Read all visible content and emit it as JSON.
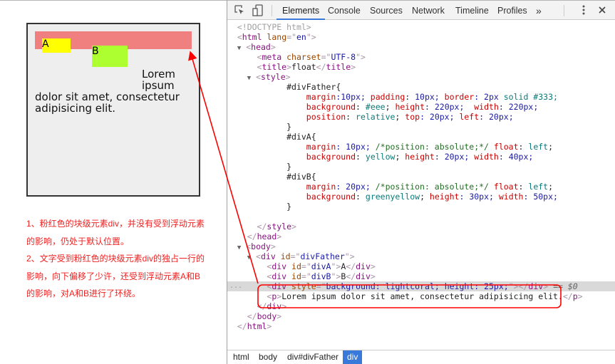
{
  "preview": {
    "box_a_label": "A",
    "box_b_label": "B",
    "paragraph_lines": [
      "Lorem",
      "ipsum",
      "dolor sit amet, consectetur",
      "adipisicing elit."
    ],
    "colors": {
      "coral": "#f08080",
      "yellow": "#ffff00",
      "greenyellow": "#adff2f",
      "father_bg": "#eeeeee",
      "father_border": "#333333"
    }
  },
  "notes": [
    "1、粉红色的块级元素div，并没有受到浮动元素的影响，仍处于默认位置。",
    "2、文字受到粉红色的块级元素div的独占一行的影响，向下偏移了少许，还受到浮动元素A和B的影响，对A和B进行了环绕。"
  ],
  "devtools": {
    "tabs": [
      "Elements",
      "Console",
      "Sources",
      "Network",
      "Timeline",
      "Profiles"
    ],
    "active_tab": "Elements",
    "more_tabs": "»",
    "icons": {
      "inspect": "inspect-element-icon",
      "device": "device-mode-icon",
      "menu": "kebab-menu-icon",
      "close": "close-icon"
    },
    "code": {
      "doctype": "<!DOCTYPE html>",
      "html_open": [
        "html",
        "lang",
        "en"
      ],
      "head": "head",
      "meta": [
        "meta",
        "charset",
        "UTF-8"
      ],
      "title": [
        "title",
        "float"
      ],
      "style": "style",
      "father_sel": "#divFather{",
      "father_l1": [
        "margin",
        ":10px; ",
        "padding",
        ": 10px; ",
        "border",
        ": 2px ",
        "solid",
        " #333;"
      ],
      "father_l2": [
        "background",
        ": ",
        "#eee",
        "; ",
        "height",
        ": 220px;  ",
        "width",
        ": 220px;"
      ],
      "father_l3": [
        "position",
        ": ",
        "relative",
        "; ",
        "top",
        ": 20px; ",
        "left",
        ": 20px;"
      ],
      "close_brace": "}",
      "a_sel": "#divA{",
      "a_l1": [
        "margin",
        ": 10px; ",
        "/*position: absolute;*/",
        " ",
        "float",
        ": ",
        "left",
        ";"
      ],
      "a_l2": [
        "background",
        ": ",
        "yellow",
        "; ",
        "height",
        ": 20px; ",
        "width",
        ": 40px;"
      ],
      "b_sel": "#divB{",
      "b_l1": [
        "margin",
        ": 20px; ",
        "/*position: absolute;*/",
        " ",
        "float",
        ": ",
        "left",
        ";"
      ],
      "b_l2": [
        "background",
        ": ",
        "greenyellow",
        "; ",
        "height",
        ": 30px; ",
        "width",
        ": 50px;"
      ],
      "style_close": "style",
      "head_close": "head",
      "body": "body",
      "div_father": [
        "div",
        "id",
        "divFather"
      ],
      "div_a": [
        "div",
        "id",
        "divA",
        "A"
      ],
      "div_b": [
        "div",
        "id",
        "divB",
        "B"
      ],
      "div_coral": [
        "div",
        "style",
        "background: lightcoral; height: 25px;"
      ],
      "selected_marker": "== $0",
      "p": [
        "p",
        "Lorem ipsum dolor sit amet, consectetur adipisicing elit."
      ],
      "div_close": "div",
      "body_close": "body",
      "html_close": "html",
      "gutter_dots": "..."
    },
    "breadcrumb": [
      "html",
      "body",
      "div#divFather",
      "div"
    ],
    "breadcrumb_active": "div"
  },
  "annotation": {
    "color": "#ff0000"
  }
}
